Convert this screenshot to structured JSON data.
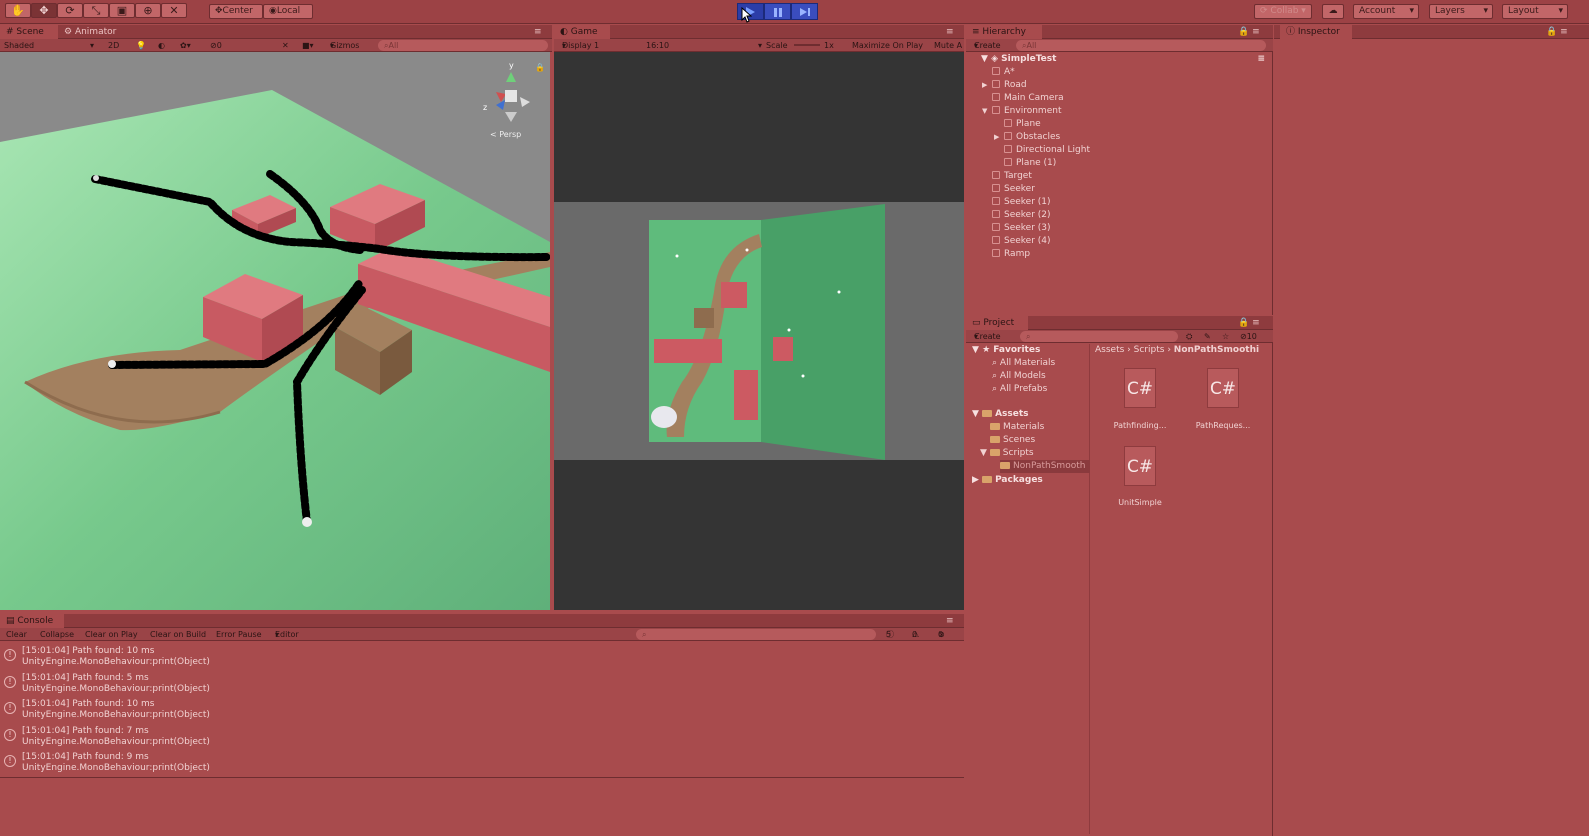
{
  "toolbar": {
    "tools": [
      {
        "name": "hand-tool",
        "glyph": "✋"
      },
      {
        "name": "move-tool",
        "glyph": "✥"
      },
      {
        "name": "rotate-tool",
        "glyph": "⟳"
      },
      {
        "name": "scale-tool",
        "glyph": "⤡"
      },
      {
        "name": "rect-tool",
        "glyph": "▣"
      },
      {
        "name": "transform-tool",
        "glyph": "⊕"
      },
      {
        "name": "custom-tool",
        "glyph": "✕"
      }
    ],
    "pivot_label": "Center",
    "space_label": "Local",
    "collab_label": "Collab",
    "account_label": "Account",
    "layers_label": "Layers",
    "layout_label": "Layout"
  },
  "scene": {
    "tab_scene": "Scene",
    "tab_animator": "Animator",
    "shading": "Shaded",
    "mode_2d": "2D",
    "fx_count": "0",
    "gizmos": "Gizmos",
    "search_placeholder": "All",
    "persp_label": "Persp",
    "axis_y": "y",
    "axis_z": "z"
  },
  "game": {
    "tab": "Game",
    "display": "Display 1",
    "aspect": "16:10",
    "scale_label": "Scale",
    "scale_value": "1x",
    "maximize": "Maximize On Play",
    "mute": "Mute A"
  },
  "hierarchy": {
    "tab": "Hierarchy",
    "create": "Create",
    "search_placeholder": "All",
    "scene_name": "SimpleTest",
    "items": [
      {
        "label": "A*",
        "level": 1,
        "arrow": ""
      },
      {
        "label": "Road",
        "level": 1,
        "arrow": "▶"
      },
      {
        "label": "Main Camera",
        "level": 1,
        "arrow": ""
      },
      {
        "label": "Environment",
        "level": 1,
        "arrow": "▼"
      },
      {
        "label": "Plane",
        "level": 2,
        "arrow": ""
      },
      {
        "label": "Obstacles",
        "level": 2,
        "arrow": "▶"
      },
      {
        "label": "Directional Light",
        "level": 2,
        "arrow": ""
      },
      {
        "label": "Plane (1)",
        "level": 2,
        "arrow": ""
      },
      {
        "label": "Target",
        "level": 1,
        "arrow": ""
      },
      {
        "label": "Seeker",
        "level": 1,
        "arrow": ""
      },
      {
        "label": "Seeker (1)",
        "level": 1,
        "arrow": ""
      },
      {
        "label": "Seeker (2)",
        "level": 1,
        "arrow": ""
      },
      {
        "label": "Seeker (3)",
        "level": 1,
        "arrow": ""
      },
      {
        "label": "Seeker (4)",
        "level": 1,
        "arrow": ""
      },
      {
        "label": "Ramp",
        "level": 1,
        "arrow": ""
      }
    ]
  },
  "inspector": {
    "tab": "Inspector"
  },
  "project": {
    "tab": "Project",
    "create": "Create",
    "count": "10",
    "favorites": "Favorites",
    "fav_items": [
      "All Materials",
      "All Models",
      "All Prefabs"
    ],
    "assets": "Assets",
    "asset_items": [
      "Materials",
      "Scenes",
      "Scripts"
    ],
    "selected_folder": "NonPathSmooth",
    "packages": "Packages",
    "breadcrumb": [
      "Assets",
      "Scripts",
      "NonPathSmoothi"
    ],
    "files": [
      {
        "icon": "C#",
        "name": "Pathfinding..."
      },
      {
        "icon": "C#",
        "name": "PathReques..."
      },
      {
        "icon": "C#",
        "name": "UnitSimple"
      }
    ]
  },
  "console": {
    "tab": "Console",
    "buttons": [
      "Clear",
      "Collapse",
      "Clear on Play",
      "Clear on Build",
      "Error Pause",
      "Editor"
    ],
    "count_log": "5",
    "count_warn": "0",
    "count_error": "0",
    "logs": [
      {
        "line1": "[15:01:04] Path found: 10 ms",
        "line2": "UnityEngine.MonoBehaviour:print(Object)"
      },
      {
        "line1": "[15:01:04] Path found: 5 ms",
        "line2": "UnityEngine.MonoBehaviour:print(Object)"
      },
      {
        "line1": "[15:01:04] Path found: 10 ms",
        "line2": "UnityEngine.MonoBehaviour:print(Object)"
      },
      {
        "line1": "[15:01:04] Path found: 7 ms",
        "line2": "UnityEngine.MonoBehaviour:print(Object)"
      },
      {
        "line1": "[15:01:04] Path found: 9 ms",
        "line2": "UnityEngine.MonoBehaviour:print(Object)"
      }
    ]
  }
}
